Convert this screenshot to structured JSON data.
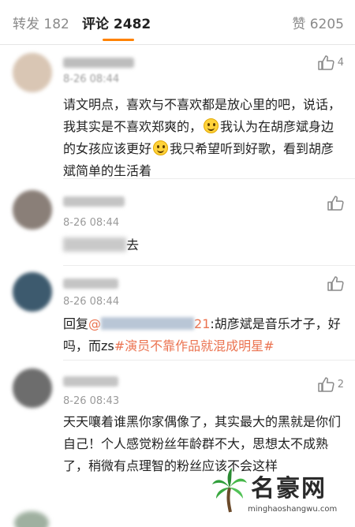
{
  "tabs": {
    "repost_label": "转发 182",
    "comments_label": "评论 2482",
    "likes_label": "赞 6205"
  },
  "comments": [
    {
      "avatar_color": "#d9c6b4",
      "name_color": "#bdbdbd",
      "time": "8-26 08:44",
      "like_count": "4",
      "text": [
        "请文明点，喜欢与不喜欢都是放心里的吧，说话，我其实是不喜欢郑爽的，",
        "我认为在胡彦斌身边的女孩应该更好",
        "我只希望听到好歌，看到胡彦斌简单的生活着"
      ]
    },
    {
      "avatar_color": "#8a7f78",
      "name_color": "#c4c4c4",
      "time": "8-26 08:44",
      "like_count": "",
      "text_tail": "去"
    },
    {
      "avatar_color": "#3d5a6e",
      "name_color": "#c4c4c4",
      "time": "8-26 08:44",
      "like_count": "",
      "reply_prefix": "回复",
      "mention_prefix": "@",
      "mention_tail": "21",
      "reply_text": ":胡彦斌是音乐才子，好吗，而zs",
      "topic": "#演员不靠作品就混成明星#"
    },
    {
      "avatar_color": "#6d6d6d",
      "name_color": "#c4c4c4",
      "time": "8-26 08:43",
      "like_count": "2",
      "text": "天天嚷着谁黑你家偶像了，其实最大的黑就是你们自己！个人感觉粉丝年龄群不大，思想太不成熟了，稍微有点理智的粉丝应该不会这样"
    }
  ],
  "watermark": {
    "title": "名豪网",
    "url": "minghaoshangwu.com"
  }
}
